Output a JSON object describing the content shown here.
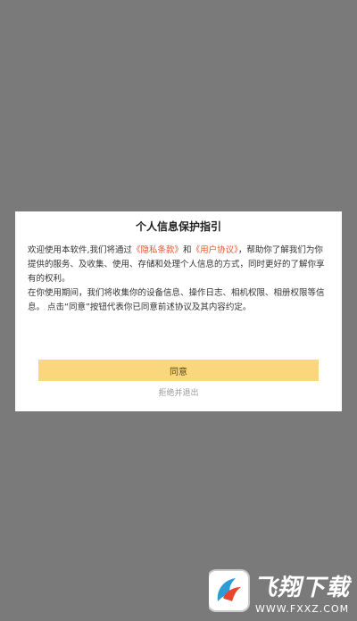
{
  "dialog": {
    "title": "个人信息保护指引",
    "text_part1": "欢迎使用本软件,我们将通过",
    "link_privacy": "《隐私条款》",
    "text_and": "和",
    "link_user": "《用户协议》",
    "text_part2": "，帮助你了解我们为你提供的服务、及收集、使用、存储和处理个人信息的方式，同时更好的了解你享有的权利。",
    "text_paragraph2": "在你使用期间，我们将收集你的设备信息、操作日志、相机权限、相册权限等信息。 点击“同意”按钮代表你已同意前述协议及其内容约定。",
    "agree_label": "同意",
    "reject_label": "拒绝并退出"
  },
  "watermark": {
    "title": "飞翔下载",
    "url": "WWW.FXXZ.COM"
  },
  "colors": {
    "backdrop": "#7a7a7a",
    "link": "#e0572f",
    "agree_button": "#fad77c",
    "reject_text": "#9a9a9a"
  }
}
